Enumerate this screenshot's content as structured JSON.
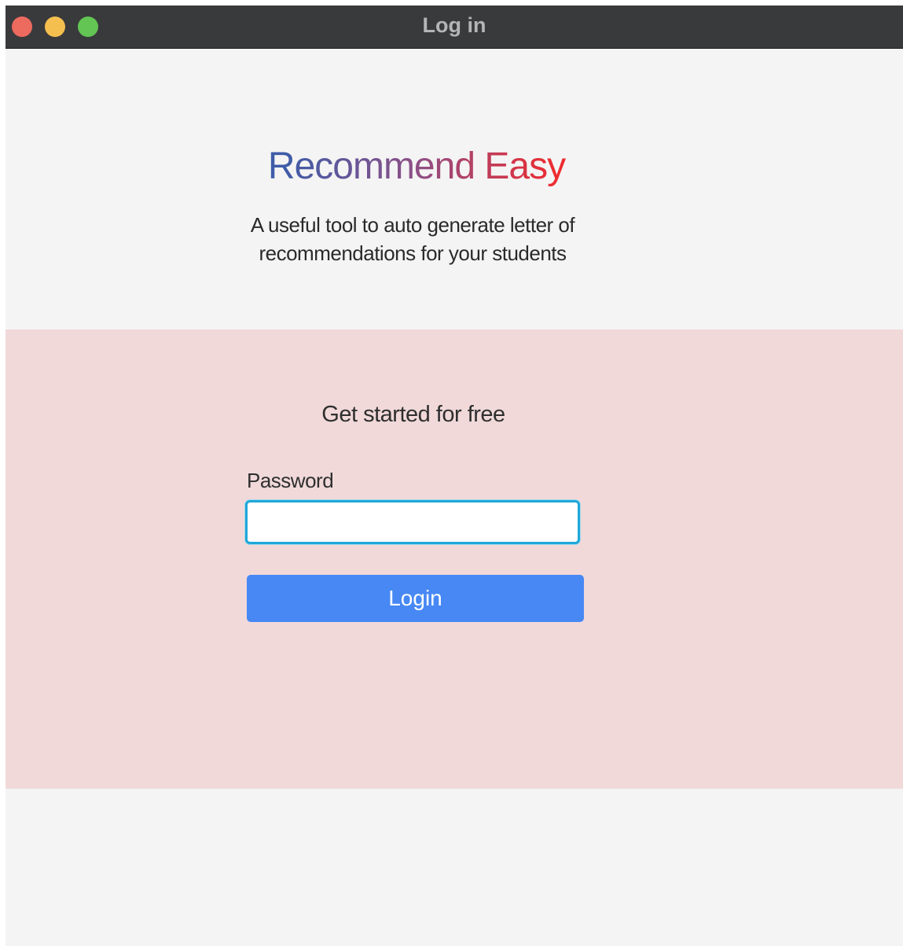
{
  "window": {
    "title": "Log in",
    "controls": {
      "close_color": "#ed6a5e",
      "minimize_color": "#f5bf4f",
      "zoom_color": "#62c554"
    }
  },
  "hero": {
    "brand_word_1": "Recommend",
    "brand_word_2": "Easy",
    "brand_colors": [
      "#3f5ca8",
      "#8e4f86",
      "#ee2b2f"
    ],
    "tagline": "A useful tool to auto generate letter of recommendations for your students"
  },
  "signup": {
    "background_color": "#f1d9da",
    "heading": "Get started for free",
    "password_label": "Password",
    "password_value": "",
    "login_label": "Login",
    "button_color": "#4788f4"
  }
}
